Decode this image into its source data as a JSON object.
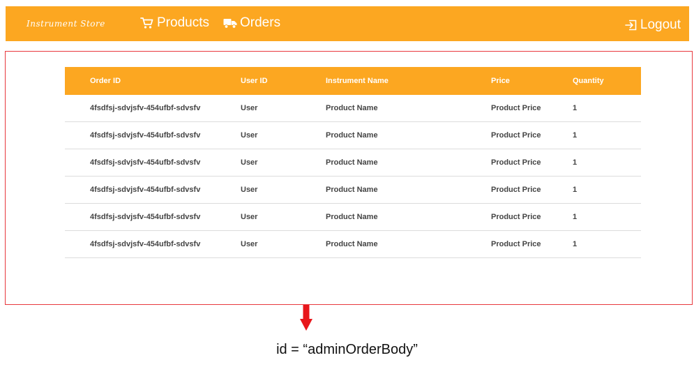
{
  "navbar": {
    "brand": "Instrument Store",
    "products_label": "Products",
    "orders_label": "Orders",
    "logout_label": "Logout",
    "accent_color": "#fca721"
  },
  "table": {
    "headers": [
      "Order ID",
      "User ID",
      "Instrument Name",
      "Price",
      "Quantity"
    ],
    "rows": [
      [
        "4fsdfsj-sdvjsfv-454ufbf-sdvsfv",
        "User",
        "Product Name",
        "Product Price",
        "1"
      ],
      [
        "4fsdfsj-sdvjsfv-454ufbf-sdvsfv",
        "User",
        "Product Name",
        "Product Price",
        "1"
      ],
      [
        "4fsdfsj-sdvjsfv-454ufbf-sdvsfv",
        "User",
        "Product Name",
        "Product Price",
        "1"
      ],
      [
        "4fsdfsj-sdvjsfv-454ufbf-sdvsfv",
        "User",
        "Product Name",
        "Product Price",
        "1"
      ],
      [
        "4fsdfsj-sdvjsfv-454ufbf-sdvsfv",
        "User",
        "Product Name",
        "Product Price",
        "1"
      ],
      [
        "4fsdfsj-sdvjsfv-454ufbf-sdvsfv",
        "User",
        "Product Name",
        "Product Price",
        "1"
      ]
    ]
  },
  "annotation": {
    "caption": "id = “adminOrderBody”",
    "highlight_color": "#e8383d"
  },
  "icons": {
    "products": "cart-icon",
    "orders": "truck-icon",
    "logout": "logout-icon",
    "arrow": "down-arrow-icon"
  }
}
